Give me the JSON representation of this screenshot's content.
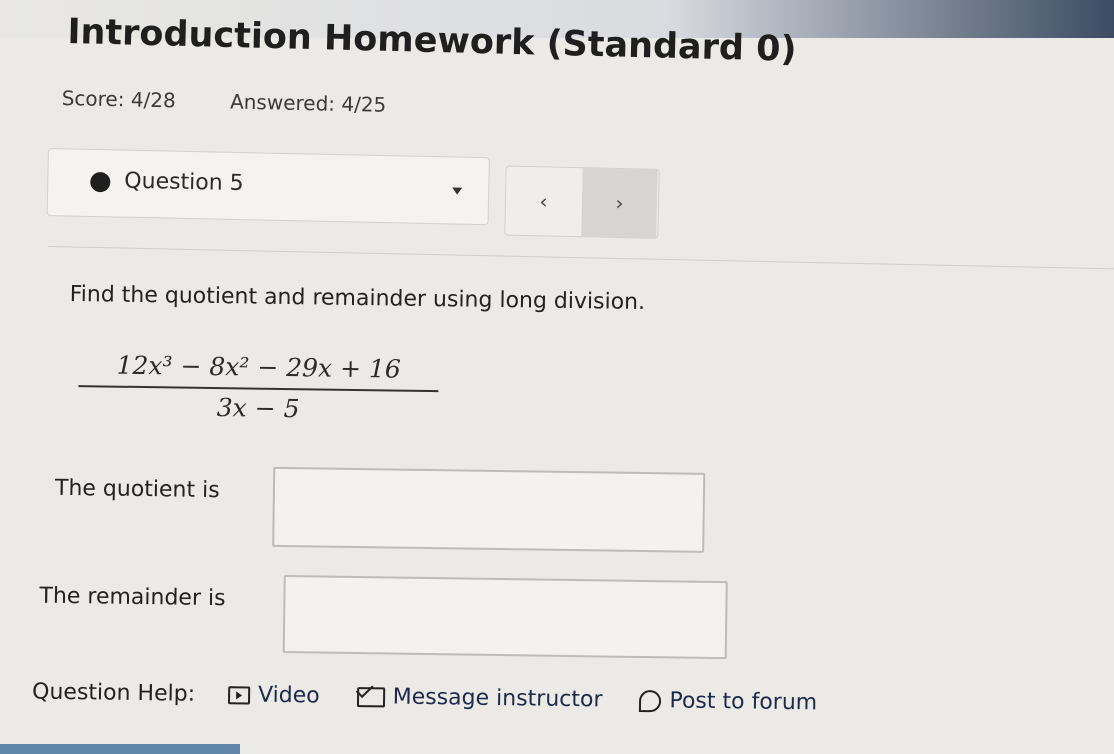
{
  "header": {
    "title": "Introduction Homework (Standard 0)",
    "score": "Score: 4/28",
    "answered": "Answered: 4/25"
  },
  "question_nav": {
    "selected_question": "Question 5",
    "prev_label": "‹",
    "next_label": "›"
  },
  "question": {
    "prompt": "Find the quotient and remainder using long division.",
    "numerator": "12x³ − 8x² − 29x + 16",
    "denominator": "3x − 5",
    "quotient_label": "The quotient is",
    "quotient_value": "",
    "remainder_label": "The remainder is",
    "remainder_value": ""
  },
  "help": {
    "label": "Question Help:",
    "video": "Video",
    "message": "Message instructor",
    "forum": "Post to forum"
  },
  "colors": {
    "background": "#eceae6",
    "bottom_strip": "#5f86a9"
  }
}
